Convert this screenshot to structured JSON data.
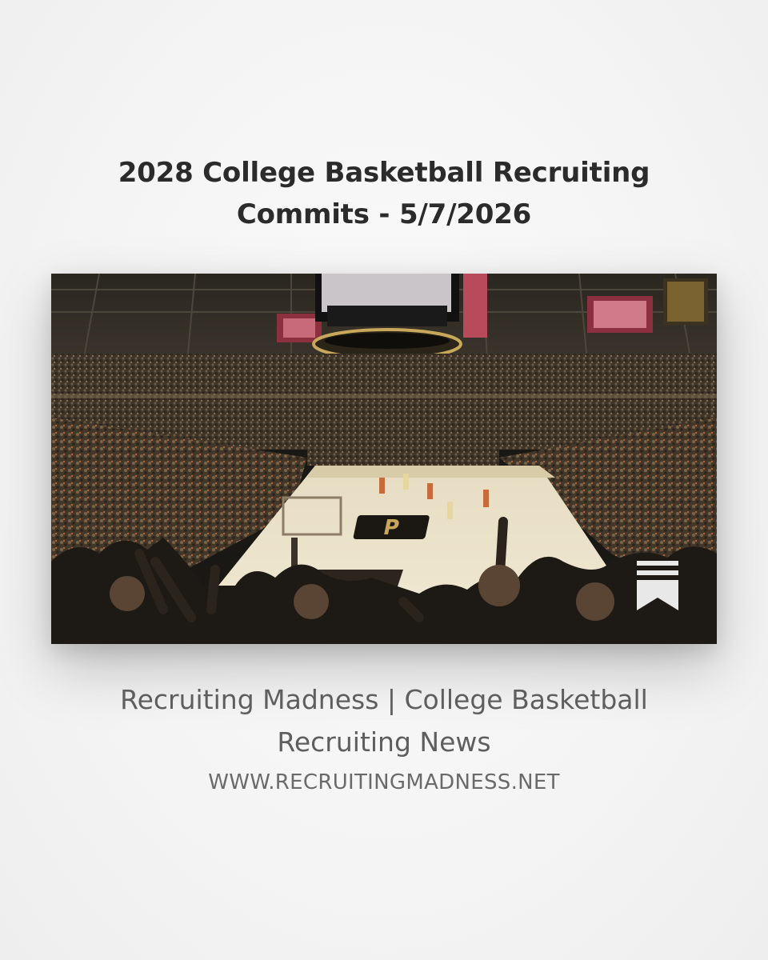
{
  "post": {
    "title": "2028 College Basketball Recruiting Commits - 5/7/2026",
    "image": {
      "alt": "Basketball arena with crowd cheering and a court with a large P logo",
      "bookmark_icon": "bookmark-icon"
    },
    "source": {
      "name": "Recruiting Madness | College Basketball Recruiting News",
      "url": "WWW.RECRUITINGMADNESS.NET"
    }
  },
  "colors": {
    "background": "#f4f4f4",
    "title": "#2b2b2b",
    "source_name": "#5e5e5e",
    "source_url": "#6a6a6a"
  }
}
